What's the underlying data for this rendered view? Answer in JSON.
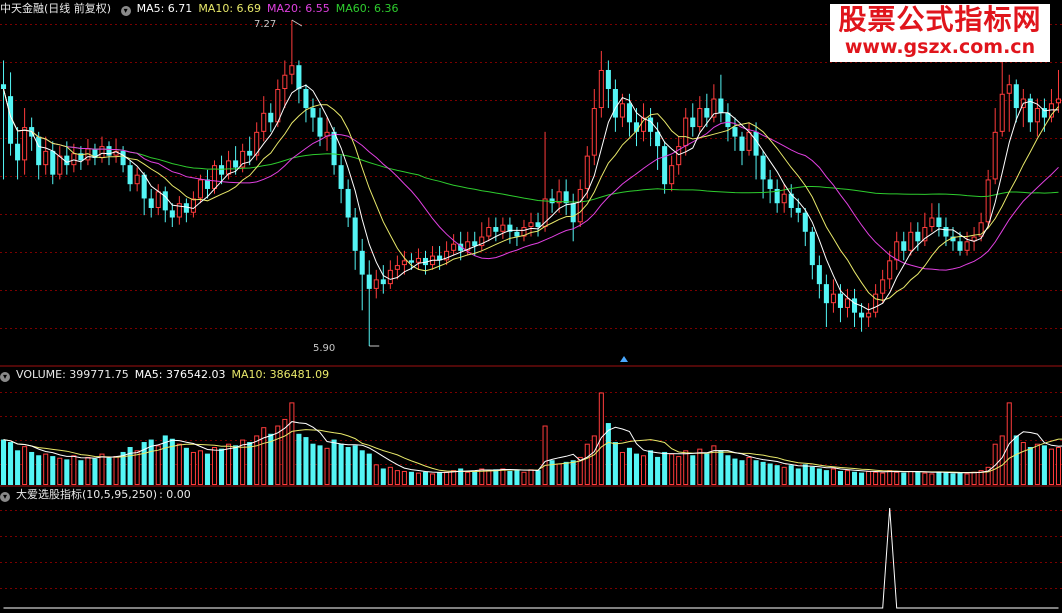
{
  "price_header": {
    "name": "中天金融",
    "period": "(日线 前复权)",
    "ma5": "MA5: 6.71",
    "ma10": "MA10: 6.69",
    "ma20": "MA20: 6.55",
    "ma60": "MA60: 6.36"
  },
  "volume_header": {
    "vol": "VOLUME: 399771.75",
    "ma5": "MA5: 376542.03",
    "ma10": "MA10: 386481.09"
  },
  "indicator_header": {
    "name": "大爱选股指标(10,5,95,250)",
    "value": ": 0.00"
  },
  "watermark": {
    "line1": "股票公式指标网",
    "line2": "www.gszx.com.cn"
  },
  "annotations": {
    "high": "7.27",
    "low": "5.90"
  },
  "colors": {
    "up": "#ff3c3c",
    "down": "#54f5f5",
    "ma5": "#ffffff",
    "ma10": "#e8e86a",
    "ma20": "#e040e0",
    "ma60": "#2ecc2e",
    "grid": "#7a0000",
    "indicator": "#ffffff"
  },
  "chart_data": {
    "type": "candlestick",
    "price_range": [
      5.9,
      7.27
    ],
    "candles": [
      [
        7.0,
        6.98,
        7.1,
        6.6
      ],
      [
        6.95,
        6.75,
        7.05,
        6.7
      ],
      [
        6.75,
        6.68,
        6.82,
        6.6
      ],
      [
        6.68,
        6.82,
        6.9,
        6.62
      ],
      [
        6.82,
        6.78,
        6.86,
        6.72
      ],
      [
        6.78,
        6.66,
        6.8,
        6.6
      ],
      [
        6.66,
        6.72,
        6.78,
        6.62
      ],
      [
        6.72,
        6.62,
        6.76,
        6.58
      ],
      [
        6.62,
        6.7,
        6.74,
        6.6
      ],
      [
        6.7,
        6.66,
        6.76,
        6.62
      ],
      [
        6.66,
        6.71,
        6.75,
        6.63
      ],
      [
        6.71,
        6.68,
        6.74,
        6.64
      ],
      [
        6.68,
        6.73,
        6.77,
        6.66
      ],
      [
        6.73,
        6.69,
        6.75,
        6.66
      ],
      [
        6.69,
        6.74,
        6.78,
        6.67
      ],
      [
        6.74,
        6.7,
        6.76,
        6.66
      ],
      [
        6.7,
        6.72,
        6.77,
        6.67
      ],
      [
        6.72,
        6.66,
        6.74,
        6.63
      ],
      [
        6.66,
        6.58,
        6.68,
        6.55
      ],
      [
        6.58,
        6.62,
        6.65,
        6.55
      ],
      [
        6.62,
        6.52,
        6.63,
        6.45
      ],
      [
        6.52,
        6.48,
        6.56,
        6.44
      ],
      [
        6.48,
        6.55,
        6.58,
        6.45
      ],
      [
        6.55,
        6.47,
        6.57,
        6.42
      ],
      [
        6.47,
        6.44,
        6.5,
        6.4
      ],
      [
        6.44,
        6.5,
        6.53,
        6.41
      ],
      [
        6.5,
        6.46,
        6.52,
        6.42
      ],
      [
        6.46,
        6.52,
        6.55,
        6.44
      ],
      [
        6.52,
        6.6,
        6.62,
        6.5
      ],
      [
        6.6,
        6.56,
        6.64,
        6.52
      ],
      [
        6.56,
        6.66,
        6.68,
        6.54
      ],
      [
        6.66,
        6.62,
        6.7,
        6.58
      ],
      [
        6.62,
        6.68,
        6.72,
        6.6
      ],
      [
        6.68,
        6.65,
        6.74,
        6.62
      ],
      [
        6.65,
        6.72,
        6.75,
        6.63
      ],
      [
        6.72,
        6.7,
        6.78,
        6.66
      ],
      [
        6.7,
        6.8,
        6.84,
        6.68
      ],
      [
        6.8,
        6.88,
        6.95,
        6.76
      ],
      [
        6.88,
        6.84,
        6.92,
        6.8
      ],
      [
        6.84,
        6.98,
        7.02,
        6.82
      ],
      [
        6.98,
        7.04,
        7.1,
        6.9
      ],
      [
        7.04,
        7.08,
        7.27,
        7.0
      ],
      [
        7.08,
        6.98,
        7.1,
        6.92
      ],
      [
        6.98,
        6.9,
        7.0,
        6.84
      ],
      [
        6.9,
        6.86,
        6.94,
        6.8
      ],
      [
        6.86,
        6.78,
        6.9,
        6.74
      ],
      [
        6.78,
        6.8,
        6.86,
        6.72
      ],
      [
        6.8,
        6.66,
        6.82,
        6.62
      ],
      [
        6.66,
        6.56,
        6.7,
        6.5
      ],
      [
        6.56,
        6.44,
        6.6,
        6.4
      ],
      [
        6.44,
        6.3,
        6.48,
        6.22
      ],
      [
        6.3,
        6.2,
        6.35,
        6.05
      ],
      [
        6.2,
        6.14,
        6.26,
        5.9
      ],
      [
        6.14,
        6.18,
        6.22,
        6.1
      ],
      [
        6.18,
        6.16,
        6.24,
        6.12
      ],
      [
        6.16,
        6.22,
        6.26,
        6.14
      ],
      [
        6.22,
        6.24,
        6.28,
        6.18
      ],
      [
        6.24,
        6.26,
        6.3,
        6.2
      ],
      [
        6.26,
        6.25,
        6.29,
        6.22
      ],
      [
        6.25,
        6.27,
        6.31,
        6.22
      ],
      [
        6.27,
        6.24,
        6.3,
        6.2
      ],
      [
        6.24,
        6.28,
        6.32,
        6.22
      ],
      [
        6.28,
        6.26,
        6.32,
        6.22
      ],
      [
        6.26,
        6.3,
        6.34,
        6.24
      ],
      [
        6.3,
        6.33,
        6.37,
        6.28
      ],
      [
        6.33,
        6.3,
        6.38,
        6.26
      ],
      [
        6.3,
        6.34,
        6.38,
        6.28
      ],
      [
        6.34,
        6.32,
        6.38,
        6.28
      ],
      [
        6.32,
        6.36,
        6.42,
        6.3
      ],
      [
        6.36,
        6.4,
        6.44,
        6.34
      ],
      [
        6.4,
        6.38,
        6.44,
        6.34
      ],
      [
        6.38,
        6.41,
        6.44,
        6.35
      ],
      [
        6.41,
        6.38,
        6.44,
        6.33
      ],
      [
        6.38,
        6.36,
        6.4,
        6.32
      ],
      [
        6.36,
        6.4,
        6.43,
        6.34
      ],
      [
        6.4,
        6.42,
        6.46,
        6.36
      ],
      [
        6.42,
        6.4,
        6.46,
        6.36
      ],
      [
        6.4,
        6.52,
        6.8,
        6.38
      ],
      [
        6.52,
        6.5,
        6.56,
        6.46
      ],
      [
        6.5,
        6.55,
        6.6,
        6.46
      ],
      [
        6.55,
        6.5,
        6.6,
        6.45
      ],
      [
        6.5,
        6.42,
        6.54,
        6.34
      ],
      [
        6.42,
        6.56,
        6.6,
        6.4
      ],
      [
        6.56,
        6.7,
        6.74,
        6.52
      ],
      [
        6.7,
        6.9,
        6.98,
        6.66
      ],
      [
        6.9,
        7.06,
        7.14,
        6.86
      ],
      [
        7.06,
        6.98,
        7.1,
        6.9
      ],
      [
        6.98,
        6.86,
        7.02,
        6.8
      ],
      [
        6.86,
        6.92,
        6.96,
        6.82
      ],
      [
        6.92,
        6.84,
        6.96,
        6.78
      ],
      [
        6.84,
        6.8,
        6.9,
        6.74
      ],
      [
        6.8,
        6.86,
        6.92,
        6.76
      ],
      [
        6.86,
        6.8,
        6.9,
        6.74
      ],
      [
        6.8,
        6.74,
        6.84,
        6.64
      ],
      [
        6.74,
        6.58,
        6.76,
        6.54
      ],
      [
        6.58,
        6.66,
        6.7,
        6.55
      ],
      [
        6.66,
        6.74,
        6.78,
        6.62
      ],
      [
        6.74,
        6.86,
        6.9,
        6.7
      ],
      [
        6.86,
        6.82,
        6.92,
        6.78
      ],
      [
        6.82,
        6.9,
        6.95,
        6.8
      ],
      [
        6.9,
        6.86,
        6.96,
        6.82
      ],
      [
        6.86,
        6.94,
        7.0,
        6.84
      ],
      [
        6.94,
        6.88,
        7.04,
        6.84
      ],
      [
        6.88,
        6.82,
        6.92,
        6.76
      ],
      [
        6.82,
        6.78,
        6.86,
        6.72
      ],
      [
        6.78,
        6.72,
        6.8,
        6.66
      ],
      [
        6.72,
        6.8,
        6.84,
        6.7
      ],
      [
        6.8,
        6.7,
        6.84,
        6.6
      ],
      [
        6.7,
        6.6,
        6.72,
        6.52
      ],
      [
        6.6,
        6.56,
        6.64,
        6.5
      ],
      [
        6.56,
        6.5,
        6.6,
        6.46
      ],
      [
        6.5,
        6.54,
        6.58,
        6.46
      ],
      [
        6.54,
        6.48,
        6.58,
        6.44
      ],
      [
        6.48,
        6.46,
        6.52,
        6.42
      ],
      [
        6.46,
        6.38,
        6.48,
        6.32
      ],
      [
        6.38,
        6.24,
        6.4,
        6.18
      ],
      [
        6.24,
        6.16,
        6.28,
        6.1
      ],
      [
        6.16,
        6.08,
        6.2,
        5.98
      ],
      [
        6.08,
        6.12,
        6.18,
        6.04
      ],
      [
        6.12,
        6.06,
        6.16,
        6.0
      ],
      [
        6.06,
        6.1,
        6.14,
        6.02
      ],
      [
        6.1,
        6.04,
        6.14,
        5.98
      ],
      [
        6.04,
        6.02,
        6.08,
        5.96
      ],
      [
        6.02,
        6.04,
        6.08,
        5.98
      ],
      [
        6.04,
        6.12,
        6.16,
        6.02
      ],
      [
        6.12,
        6.18,
        6.22,
        6.08
      ],
      [
        6.18,
        6.26,
        6.3,
        6.14
      ],
      [
        6.26,
        6.34,
        6.38,
        6.22
      ],
      [
        6.34,
        6.3,
        6.38,
        6.26
      ],
      [
        6.3,
        6.38,
        6.42,
        6.28
      ],
      [
        6.38,
        6.34,
        6.42,
        6.3
      ],
      [
        6.34,
        6.4,
        6.46,
        6.32
      ],
      [
        6.4,
        6.44,
        6.5,
        6.38
      ],
      [
        6.44,
        6.4,
        6.5,
        6.36
      ],
      [
        6.4,
        6.36,
        6.44,
        6.32
      ],
      [
        6.36,
        6.34,
        6.4,
        6.3
      ],
      [
        6.34,
        6.3,
        6.38,
        6.28
      ],
      [
        6.3,
        6.34,
        6.38,
        6.28
      ],
      [
        6.34,
        6.36,
        6.4,
        6.3
      ],
      [
        6.36,
        6.42,
        6.46,
        6.34
      ],
      [
        6.42,
        6.6,
        6.64,
        6.4
      ],
      [
        6.6,
        6.8,
        6.9,
        6.58
      ],
      [
        6.8,
        6.96,
        7.18,
        6.78
      ],
      [
        6.96,
        7.0,
        7.04,
        6.8
      ],
      [
        7.0,
        6.9,
        7.02,
        6.84
      ],
      [
        6.9,
        6.94,
        6.98,
        6.82
      ],
      [
        6.94,
        6.84,
        6.96,
        6.8
      ],
      [
        6.84,
        6.9,
        6.94,
        6.78
      ],
      [
        6.9,
        6.86,
        6.94,
        6.8
      ],
      [
        6.86,
        6.92,
        6.98,
        6.84
      ],
      [
        6.92,
        6.94,
        7.06,
        6.88
      ]
    ],
    "volume": [
      0.55,
      0.52,
      0.42,
      0.47,
      0.4,
      0.36,
      0.38,
      0.35,
      0.33,
      0.31,
      0.36,
      0.3,
      0.34,
      0.32,
      0.38,
      0.33,
      0.35,
      0.4,
      0.46,
      0.42,
      0.52,
      0.55,
      0.48,
      0.6,
      0.56,
      0.5,
      0.45,
      0.4,
      0.42,
      0.38,
      0.46,
      0.44,
      0.5,
      0.48,
      0.55,
      0.52,
      0.6,
      0.7,
      0.62,
      0.72,
      0.8,
      1.0,
      0.62,
      0.58,
      0.5,
      0.48,
      0.45,
      0.55,
      0.5,
      0.46,
      0.48,
      0.42,
      0.38,
      0.25,
      0.2,
      0.22,
      0.18,
      0.17,
      0.16,
      0.15,
      0.16,
      0.14,
      0.15,
      0.16,
      0.18,
      0.2,
      0.16,
      0.17,
      0.2,
      0.18,
      0.19,
      0.2,
      0.17,
      0.18,
      0.16,
      0.19,
      0.18,
      0.72,
      0.3,
      0.26,
      0.28,
      0.3,
      0.34,
      0.5,
      0.6,
      1.12,
      0.75,
      0.52,
      0.4,
      0.45,
      0.38,
      0.36,
      0.42,
      0.34,
      0.4,
      0.38,
      0.35,
      0.42,
      0.36,
      0.44,
      0.38,
      0.48,
      0.42,
      0.36,
      0.32,
      0.3,
      0.34,
      0.3,
      0.28,
      0.26,
      0.24,
      0.22,
      0.24,
      0.2,
      0.25,
      0.22,
      0.2,
      0.18,
      0.2,
      0.17,
      0.18,
      0.16,
      0.15,
      0.17,
      0.16,
      0.15,
      0.18,
      0.16,
      0.15,
      0.17,
      0.16,
      0.15,
      0.14,
      0.16,
      0.15,
      0.14,
      0.15,
      0.14,
      0.16,
      0.18,
      0.22,
      0.5,
      0.6,
      1.0,
      0.6,
      0.52,
      0.46,
      0.5,
      0.48,
      0.44,
      0.46,
      0.5,
      0.48
    ],
    "indicator_spike_index": 126
  }
}
